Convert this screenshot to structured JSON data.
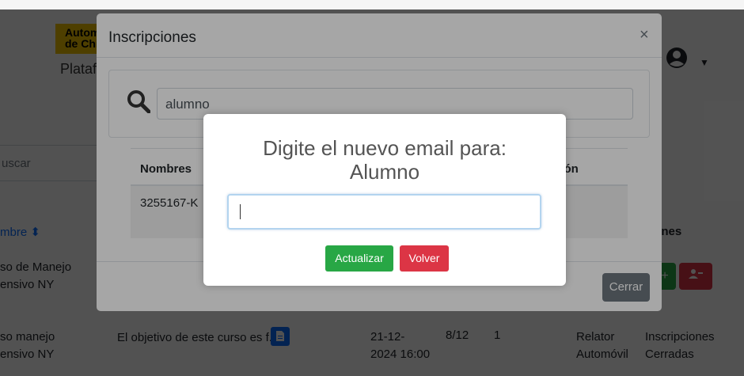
{
  "background": {
    "brand_line1": "Autom",
    "brand_line2": "de Chi",
    "brand_subtitle": "Plataf",
    "search_placeholder": "uscar",
    "col_nombre": "mbre ⬍",
    "col_acciones": "iones",
    "rows": [
      {
        "name_line1": "so de Manejo",
        "name_line2": "ensivo NY"
      },
      {
        "name_line1": "so manejo",
        "name_line2": "ensivo NY",
        "description": "El objetivo de este curso es f...",
        "date_line1": "21-12-",
        "date_line2": "2024 16:00",
        "fraction": "8/12",
        "count": "1",
        "relator_line1": "Relator",
        "relator_line2": "Automóvil",
        "status_line1": "Inscripciones",
        "status_line2": "Cerradas"
      }
    ]
  },
  "modal": {
    "title": "Inscripciones",
    "close_symbol": "×",
    "search_value": "alumno",
    "table_header_nombres": "Nombres",
    "table_header_partial": "ción",
    "row_id": "3255167-K",
    "close_button": "Cerrar"
  },
  "dialog": {
    "title_line1": "Digite el nuevo email para:",
    "title_line2": "Alumno",
    "input_value": "",
    "confirm_button": "Actualizar",
    "cancel_button": "Volver"
  },
  "colors": {
    "success": "#28a745",
    "danger": "#dc3545",
    "secondary": "#6c757d",
    "brand_yellow": "#f2c500"
  }
}
